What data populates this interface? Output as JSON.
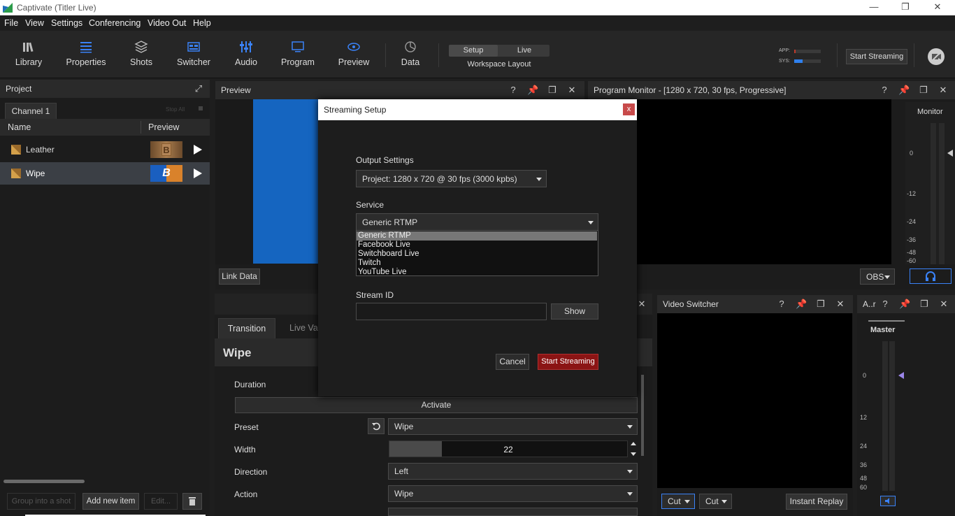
{
  "window": {
    "title": "Captivate (Titler Live)"
  },
  "menu": [
    "File",
    "View",
    "Settings",
    "Conferencing",
    "Video Out",
    "Help"
  ],
  "toolbar": {
    "items": [
      {
        "label": "Library",
        "icon": "library-icon"
      },
      {
        "label": "Properties",
        "icon": "list-icon"
      },
      {
        "label": "Shots",
        "icon": "layers-icon"
      },
      {
        "label": "Switcher",
        "icon": "switcher-icon"
      },
      {
        "label": "Audio",
        "icon": "sliders-icon"
      },
      {
        "label": "Program",
        "icon": "monitor-icon"
      },
      {
        "label": "Preview",
        "icon": "eye-icon"
      },
      {
        "label": "Data",
        "icon": "pie-chart-icon"
      }
    ],
    "workspace": {
      "setup": "Setup",
      "live": "Live",
      "label": "Workspace Layout"
    },
    "meters": {
      "app": "APP:",
      "sys": "SYS:"
    },
    "start_streaming": "Start Streaming",
    "accent": "#3a82f7"
  },
  "project": {
    "title": "Project",
    "tab": "Channel 1",
    "stop_all": "Stop All",
    "columns": {
      "name": "Name",
      "preview": "Preview"
    },
    "items": [
      {
        "name": "Leather",
        "selected": false
      },
      {
        "name": "Wipe",
        "selected": true
      }
    ],
    "footer": {
      "group": "Group into a shot",
      "add": "Add new item",
      "edit": "Edit..."
    }
  },
  "preview": {
    "title": "Preview",
    "link_data": "Link Data"
  },
  "program": {
    "title": "Program Monitor - [1280 x 720, 30 fps, Progressive]",
    "monitor_label": "Monitor",
    "obs": "OBS",
    "ticks": [
      "0",
      "-12",
      "-24",
      "-36",
      "-48",
      "-60"
    ]
  },
  "properties": {
    "tabs": [
      "Transition",
      "Live Va"
    ],
    "heading": "Wipe",
    "duration": "Duration",
    "activate": "Activate",
    "preset": {
      "label": "Preset",
      "value": "Wipe"
    },
    "width": {
      "label": "Width",
      "value": "22",
      "fill": 0.22
    },
    "direction": {
      "label": "Direction",
      "value": "Left"
    },
    "action": {
      "label": "Action",
      "value": "Wipe"
    }
  },
  "switcher": {
    "title": "Video Switcher",
    "cut1": "Cut",
    "cut2": "Cut",
    "instant_replay": "Instant Replay"
  },
  "audio": {
    "title": "A..r",
    "master": "Master",
    "ticks": [
      "0",
      "12",
      "24",
      "36",
      "48",
      "60"
    ]
  },
  "dialog": {
    "title": "Streaming Setup",
    "close": "x",
    "output_label": "Output Settings",
    "output_value": "Project: 1280 x 720 @ 30 fps (3000 kpbs)",
    "service_label": "Service",
    "service_value": "Generic RTMP",
    "service_options": [
      "Generic RTMP",
      "Facebook Live",
      "Switchboard Live",
      "Twitch",
      "YouTube Live"
    ],
    "stream_id_label": "Stream ID",
    "show": "Show",
    "cancel": "Cancel",
    "start": "Start Streaming"
  }
}
